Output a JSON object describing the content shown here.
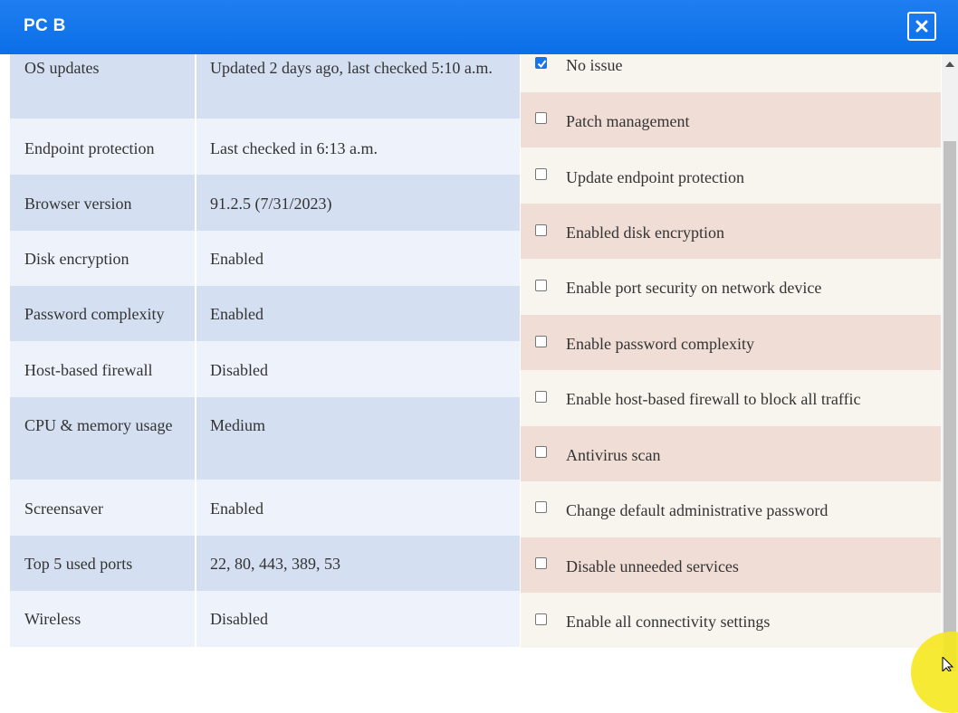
{
  "window": {
    "title": "PC B",
    "close_icon": "close-icon"
  },
  "device_info": [
    {
      "name": "OS updates",
      "value": "Updated 2 days ago, last checked 5:10 a.m."
    },
    {
      "name": "Endpoint protection",
      "value": "Last checked in 6:13 a.m."
    },
    {
      "name": "Browser version",
      "value": "91.2.5 (7/31/2023)"
    },
    {
      "name": "Disk encryption",
      "value": "Enabled"
    },
    {
      "name": "Password complexity",
      "value": "Enabled"
    },
    {
      "name": "Host-based firewall",
      "value": "Disabled"
    },
    {
      "name": "CPU & memory usage",
      "value": "Medium"
    },
    {
      "name": "Screensaver",
      "value": "Enabled"
    },
    {
      "name": "Top 5 used ports",
      "value": "22, 80, 443, 389, 53"
    },
    {
      "name": "Wireless",
      "value": "Disabled"
    }
  ],
  "remediation_options": [
    {
      "label": "No issue",
      "checked": true
    },
    {
      "label": "Patch management",
      "checked": false
    },
    {
      "label": "Update endpoint protection",
      "checked": false
    },
    {
      "label": "Enabled disk encryption",
      "checked": false
    },
    {
      "label": "Enable port security on network device",
      "checked": false
    },
    {
      "label": "Enable password complexity",
      "checked": false
    },
    {
      "label": "Enable host-based firewall to block all traffic",
      "checked": false
    },
    {
      "label": "Antivirus scan",
      "checked": false
    },
    {
      "label": "Change default administrative password",
      "checked": false
    },
    {
      "label": "Disable unneeded services",
      "checked": false
    },
    {
      "label": "Enable all connectivity settings",
      "checked": false
    }
  ],
  "colors": {
    "titlebar": "#1a73e8",
    "left_shade": "#d4e0f2",
    "left_plain": "#eef3fb",
    "right_peach": "#f0ddd6",
    "right_cream": "#f8f5ef",
    "checkbox_checked": "#1a73e8"
  }
}
